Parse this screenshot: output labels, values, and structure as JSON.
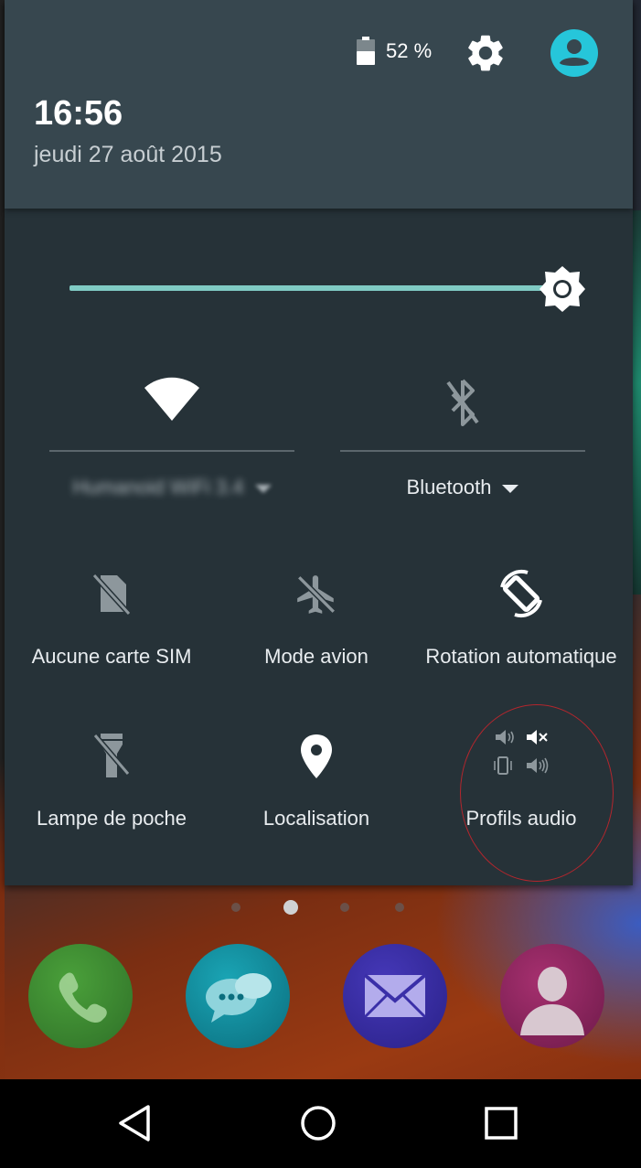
{
  "status": {
    "battery_icon": "battery-icon",
    "battery_percent": "52 %",
    "settings_icon": "gear-icon",
    "user_icon": "account-circle-icon",
    "accent_color": "#26c6da"
  },
  "clock": {
    "time": "16:56",
    "date": "jeudi 27 août 2015"
  },
  "brightness": {
    "level": 0.97,
    "track_color": "#80cbc4",
    "icon": "brightness-icon"
  },
  "wifi": {
    "icon": "wifi-icon",
    "network_name": "Humanoid WiFi 3.4"
  },
  "bluetooth": {
    "icon": "bluetooth-off-icon",
    "label": "Bluetooth"
  },
  "tiles": [
    {
      "label": "Aucune carte SIM",
      "icon": "no-sim-icon"
    },
    {
      "label": "Mode avion",
      "icon": "airplane-icon"
    },
    {
      "label": "Rotation automatique",
      "icon": "auto-rotate-icon"
    },
    {
      "label": "Lampe de poche",
      "icon": "flashlight-off-icon"
    },
    {
      "label": "Localisation",
      "icon": "location-pin-icon"
    },
    {
      "label": "Profils audio",
      "icon": "audio-profiles-icon"
    }
  ],
  "pager": {
    "pages": 4,
    "current": 2
  },
  "dock": [
    {
      "icon": "phone-icon",
      "color": "#3e8e2f"
    },
    {
      "icon": "messaging-icon",
      "color": "#0e8ea0"
    },
    {
      "icon": "email-icon",
      "color": "#3a2fa8"
    },
    {
      "icon": "contacts-icon",
      "color": "#9c2a6a"
    }
  ],
  "navigation": {
    "back_icon": "back-icon",
    "home_icon": "home-icon",
    "recents_icon": "recents-icon"
  }
}
